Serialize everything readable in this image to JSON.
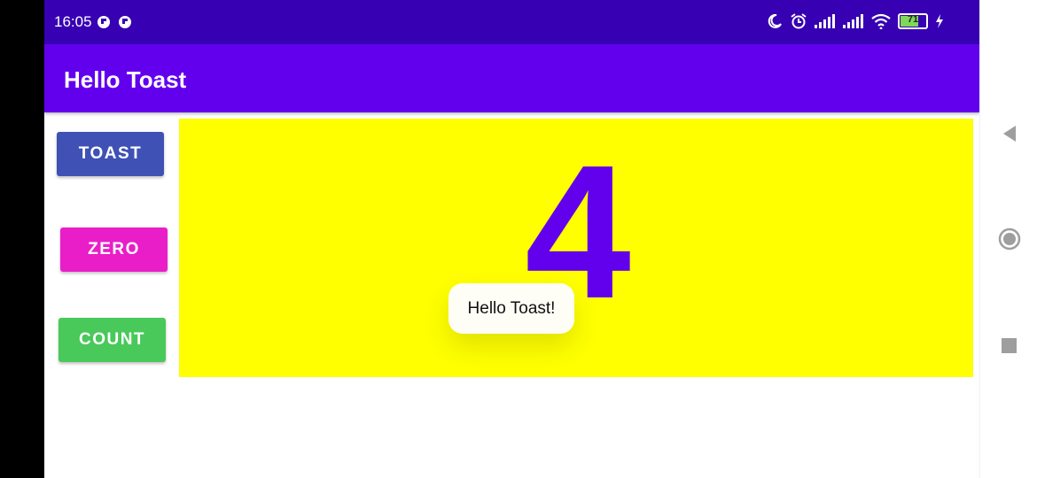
{
  "status_bar": {
    "time": "16:05",
    "left_icons": [
      "notification-icon",
      "notification-icon"
    ],
    "right_icons": [
      "moon-icon",
      "alarm-icon",
      "signal-icon",
      "signal-icon",
      "wifi-icon",
      "battery-icon",
      "charging-icon"
    ],
    "battery_level": "71"
  },
  "app_bar": {
    "title": "Hello Toast"
  },
  "buttons": {
    "toast": "TOAST",
    "zero": "ZERO",
    "count": "COUNT"
  },
  "counter": {
    "value": "4"
  },
  "toast_message": "Hello Toast!",
  "colors": {
    "status_bar": "#3700b3",
    "app_bar": "#6200ee",
    "toast_button": "#3f51b5",
    "zero_button": "#e91ec8",
    "count_button": "#48c95a",
    "panel": "#ffff00",
    "count_text": "#6200ee"
  },
  "nav_bar": {
    "icons": [
      "back-icon",
      "home-icon",
      "recents-icon"
    ]
  }
}
